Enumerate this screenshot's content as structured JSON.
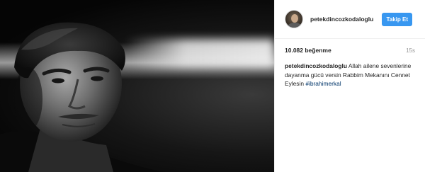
{
  "account": {
    "username": "petekdincozkodaloglu"
  },
  "header": {
    "follow_label": "Takip Et"
  },
  "stats": {
    "likes": "10.082 beğenme",
    "time": "15s"
  },
  "caption": {
    "username": "petekdincozkodaloglu",
    "text": " Allah ailene sevenlerine dayanma gücü versin Rabbim Mekanını Cennet Eylesin ",
    "hashtag": "#ibrahimerkal"
  },
  "colors": {
    "follow_button": "#3897f0",
    "hashtag": "#003569",
    "muted": "#999999"
  }
}
